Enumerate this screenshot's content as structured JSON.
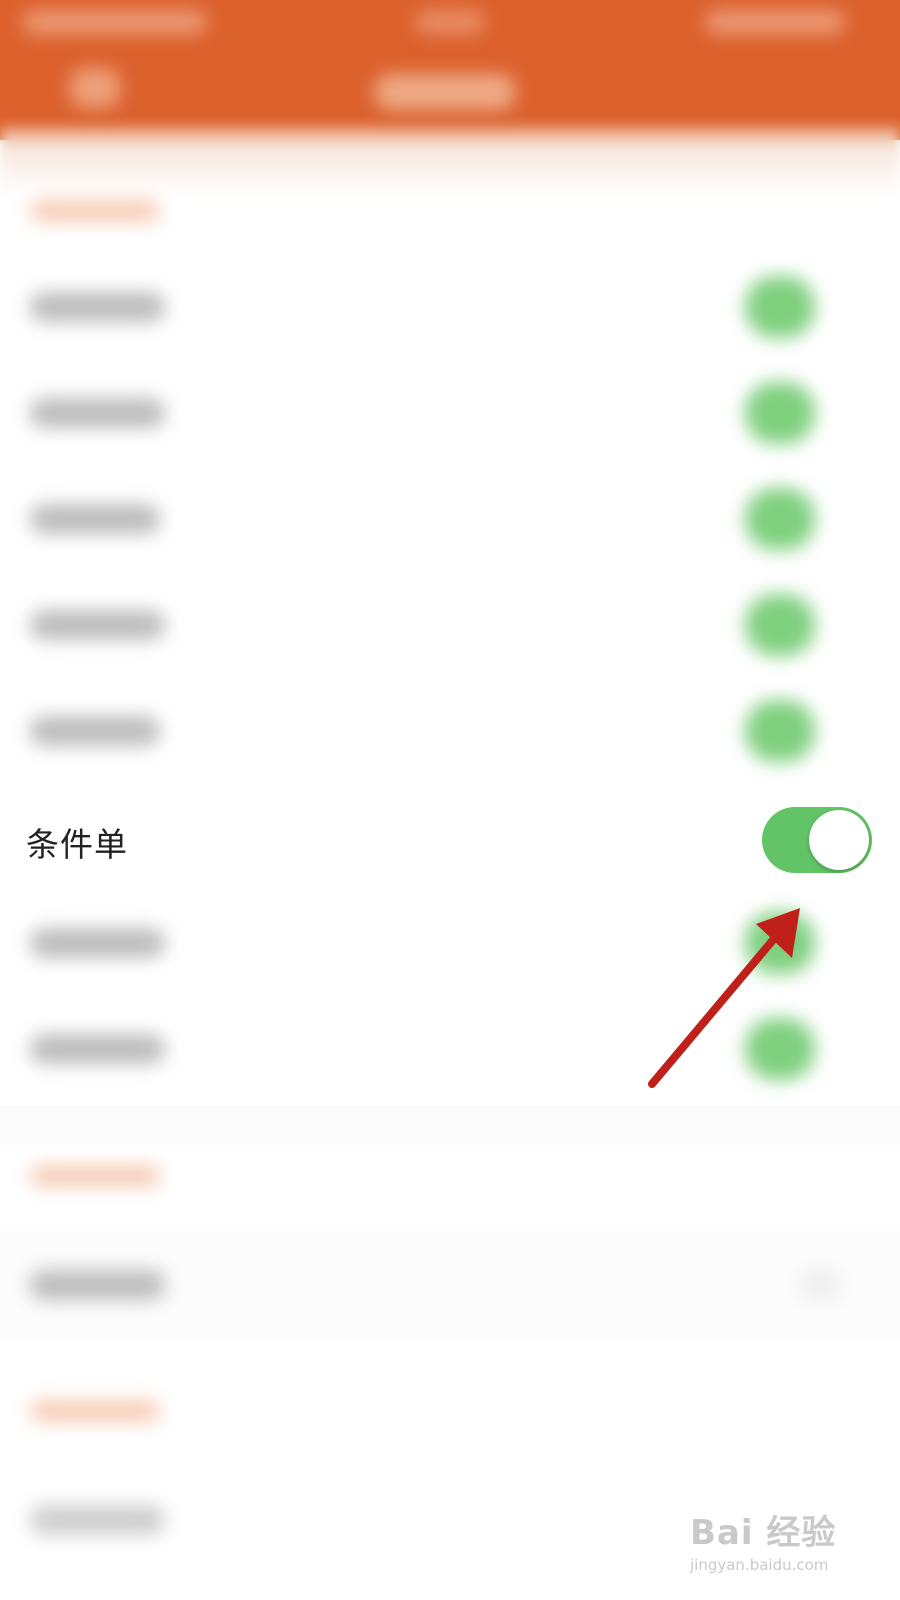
{
  "settings_row": {
    "label": "条件单",
    "toggle_state": "on"
  },
  "watermark": {
    "brand": "Bai 经验",
    "url": "jingyan.baidu.com"
  },
  "colors": {
    "header": "#db612d",
    "toggle_on": "#62c466",
    "arrow": "#c0201a"
  },
  "icons": {
    "back": "back-arrow-icon",
    "annotation": "red-arrow-annotation"
  }
}
